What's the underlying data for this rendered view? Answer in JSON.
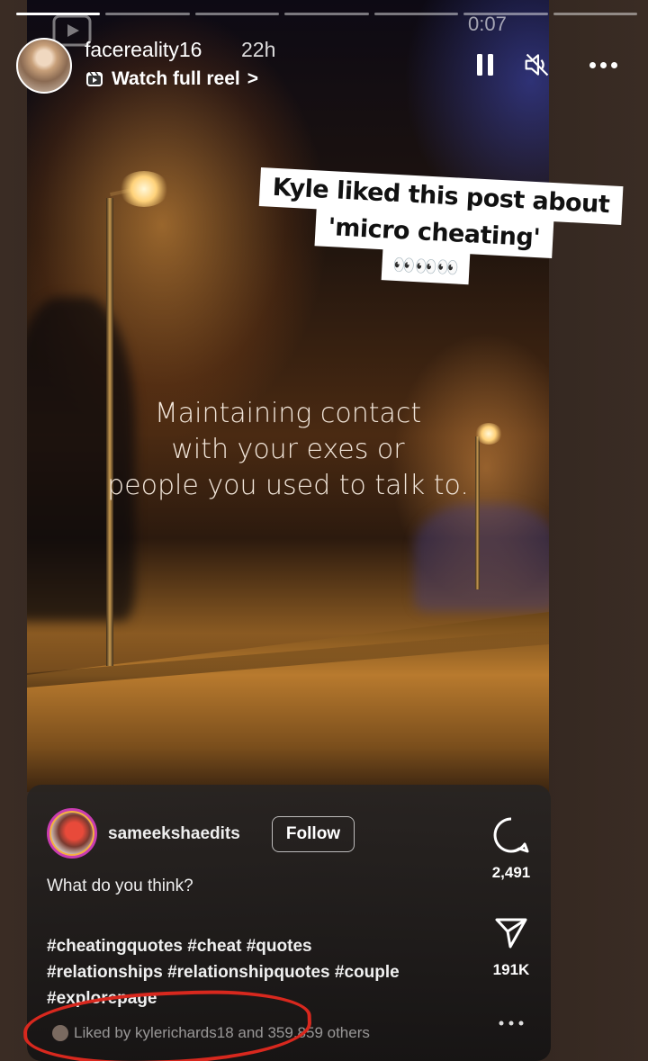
{
  "story": {
    "username": "facereality16",
    "time": "22h",
    "reel_link": "Watch full reel",
    "reel_chevron": ">",
    "clock": "0:07",
    "progress_segments": 7,
    "progress_completed": 1
  },
  "sticker": {
    "line1": "Kyle liked this post about",
    "line2": "'micro cheating'",
    "line3": "👀👀👀"
  },
  "reel": {
    "overlay_line1": "Maintaining contact",
    "overlay_line2": "with your exes or",
    "overlay_line3": "people you used to talk to."
  },
  "post": {
    "username": "sameekshaedits",
    "follow_label": "Follow",
    "caption": "What do you think?",
    "hashtags_line1": "#cheatingquotes #cheat #quotes",
    "hashtags_line2": "#relationships #relationshipquotes #couple",
    "hashtags_line3": "#explorepage",
    "liked_by": "Liked by kylerichards18 and 359,859 others",
    "comments": "2,491",
    "shares": "191K"
  },
  "colors": {
    "highlight_circle": "#d8281e",
    "sticker_bg": "#ffffff"
  },
  "icons": [
    "reel-icon",
    "pause-icon",
    "mute-icon",
    "more-icon",
    "comment-icon",
    "share-icon",
    "ellipsis-icon"
  ]
}
